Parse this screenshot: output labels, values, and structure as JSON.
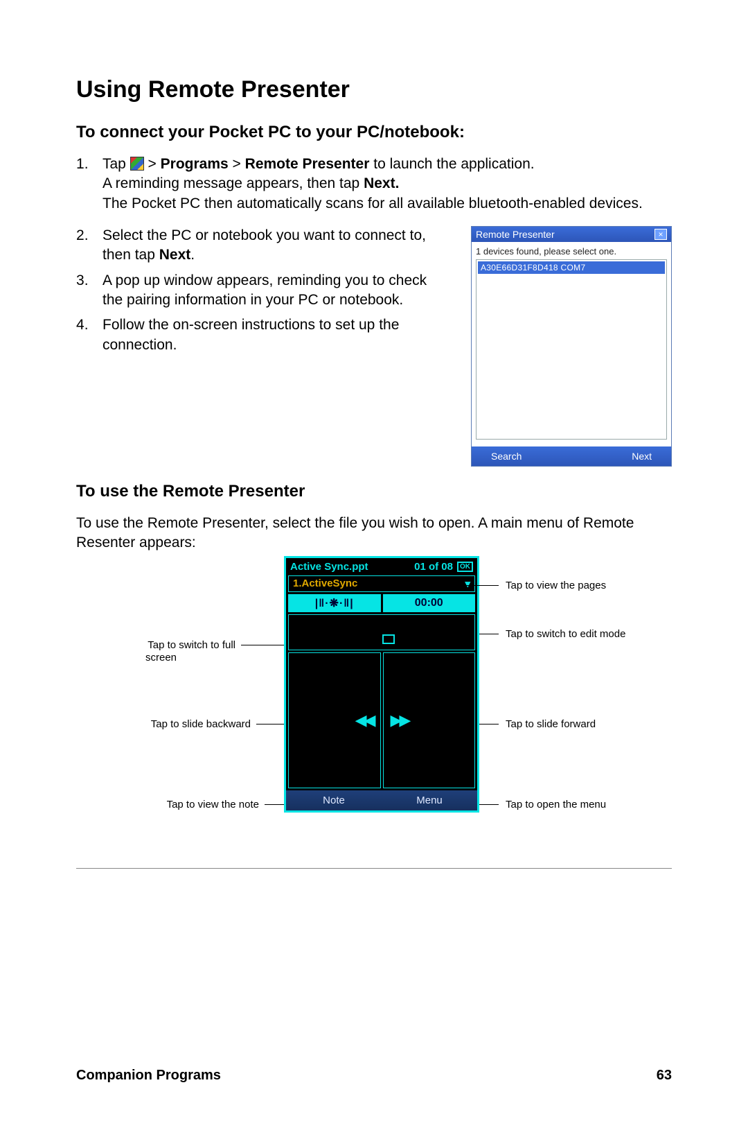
{
  "title": "Using Remote Presenter",
  "section1": {
    "heading": "To connect your Pocket PC to your PC/notebook:",
    "step1a": "Tap ",
    "step1b": " > ",
    "step1c": "Programs",
    "step1d": " > ",
    "step1e": "Remote Presenter",
    "step1f": " to launch the application.",
    "step1line2a": "A reminding message appears, then tap ",
    "step1line2b": "Next.",
    "step1line3": "The Pocket PC then automatically scans for all available bluetooth-enabled devices.",
    "step2a": "Select the PC or notebook you want to connect to, then tap ",
    "step2b": "Next",
    "step2c": ".",
    "step3": "A pop up window appears, reminding you to check the pairing information in your PC or notebook.",
    "step4": "Follow the on-screen instructions to set up the connection."
  },
  "shot1": {
    "title": "Remote Presenter",
    "hint": "1 devices found, please select one.",
    "item": "A30E66D31F8D418 COM7",
    "search": "Search",
    "next": "Next"
  },
  "section2": {
    "heading": "To use the Remote Presenter",
    "para": "To use the Remote Presenter, select the file you wish to open. A main menu of Remote Resenter appears:"
  },
  "shot2": {
    "filename": "Active Sync.ppt",
    "counter": "01 of 08",
    "ok": "OK",
    "dropdown": "1.ActiveSync",
    "signal": "|‖·❋·‖|",
    "timer": "00:00",
    "note": "Note",
    "menu": "Menu"
  },
  "callouts": {
    "viewpages": "Tap to view the pages",
    "editmode": "Tap to switch to edit mode",
    "forward": "Tap to slide forward",
    "openmenu": "Tap to open the menu",
    "fullscreen1": "Tap to switch to full",
    "fullscreen2": "screen",
    "backward": "Tap to slide backward",
    "viewnote": "Tap to view the note"
  },
  "footer": {
    "left": "Companion Programs",
    "right": "63"
  }
}
